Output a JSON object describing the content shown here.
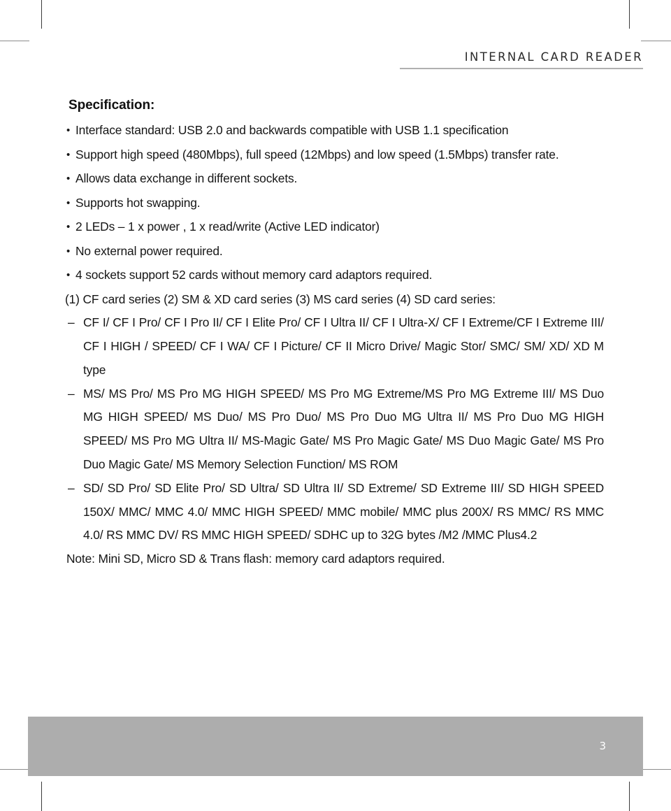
{
  "page": {
    "header_title": "INTERNAL CARD READER",
    "page_number": "3",
    "footer_color": "#adadad",
    "text_color": "#161616"
  },
  "spec": {
    "title": "Specification:",
    "bullets": [
      "Interface standard: USB 2.0 and backwards compatible with USB 1.1 specification",
      "Support high speed (480Mbps), full speed (12Mbps) and low speed (1.5Mbps) transfer rate.",
      "Allows data exchange in different sockets.",
      "Supports hot swapping.",
      "2 LEDs – 1 x power , 1 x read/write (Active LED indicator)",
      "No external power required.",
      "4 sockets support 52 cards without memory card adaptors required."
    ],
    "series_intro": "(1) CF card series (2) SM & XD card series (3) MS card series (4) SD card series:",
    "series": [
      "CF I/ CF I Pro/ CF I Pro II/ CF I Elite Pro/ CF I Ultra II/ CF I Ultra-X/ CF I Extreme/CF I Extreme III/ CF I HIGH / SPEED/ CF I WA/ CF I Picture/ CF II Micro Drive/ Magic Stor/ SMC/ SM/ XD/ XD M type",
      "MS/ MS Pro/ MS Pro MG HIGH SPEED/ MS Pro MG Extreme/MS Pro MG Extreme III/ MS Duo MG HIGH SPEED/ MS Duo/ MS Pro Duo/ MS Pro Duo MG Ultra II/ MS Pro Duo MG HIGH SPEED/ MS Pro MG Ultra II/ MS-Magic Gate/ MS Pro Magic Gate/ MS Duo Magic Gate/ MS Pro Duo Magic Gate/ MS Memory Selection Function/ MS ROM",
      "SD/ SD Pro/ SD Elite Pro/ SD Ultra/ SD Ultra II/ SD Extreme/ SD Extreme III/ SD HIGH SPEED 150X/ MMC/ MMC 4.0/ MMC HIGH SPEED/ MMC mobile/ MMC plus 200X/ RS MMC/ RS MMC 4.0/ RS MMC DV/ RS MMC HIGH SPEED/ SDHC up to 32G bytes /M2 /MMC Plus4.2"
    ],
    "note": "Note: Mini SD, Micro SD & Trans flash: memory card adaptors required."
  }
}
